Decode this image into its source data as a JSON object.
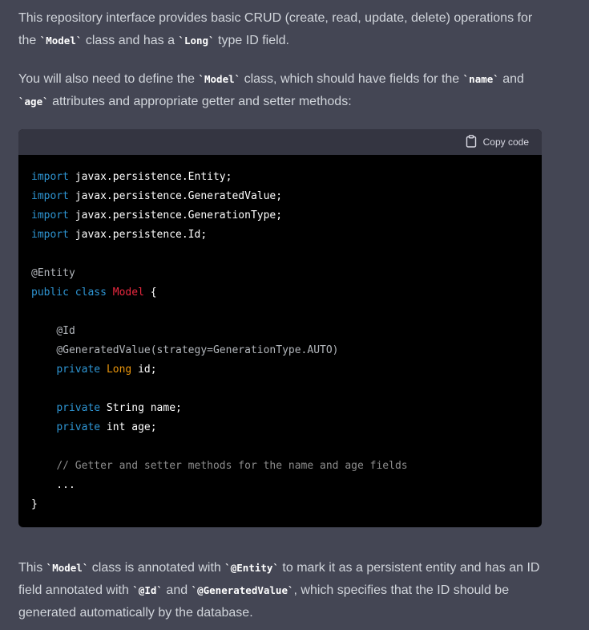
{
  "intro": {
    "p1": [
      "This repository interface provides basic CRUD (create, read, update, delete) operations for the ",
      "`Model`",
      " class and has a ",
      "`Long`",
      " type ID field."
    ],
    "p2": [
      "You will also need to define the ",
      "`Model`",
      " class, which should have fields for the ",
      "`name`",
      " and ",
      "`age`",
      " attributes and appropriate getter and setter methods:"
    ]
  },
  "code_block": {
    "copy_label": "Copy code",
    "copy_icon": "clipboard-icon",
    "lines": [
      [
        {
          "t": "import",
          "c": "kw"
        },
        {
          "t": " javax.persistence.Entity;"
        }
      ],
      [
        {
          "t": "import",
          "c": "kw"
        },
        {
          "t": " javax.persistence.GeneratedValue;"
        }
      ],
      [
        {
          "t": "import",
          "c": "kw"
        },
        {
          "t": " javax.persistence.GenerationType;"
        }
      ],
      [
        {
          "t": "import",
          "c": "kw"
        },
        {
          "t": " javax.persistence.Id;"
        }
      ],
      [],
      [
        {
          "t": "@Entity",
          "c": "anno"
        }
      ],
      [
        {
          "t": "public",
          "c": "kw"
        },
        {
          "t": " "
        },
        {
          "t": "class",
          "c": "kw"
        },
        {
          "t": " "
        },
        {
          "t": "Model",
          "c": "cls"
        },
        {
          "t": " {"
        }
      ],
      [],
      [
        {
          "t": "    "
        },
        {
          "t": "@Id",
          "c": "anno"
        }
      ],
      [
        {
          "t": "    "
        },
        {
          "t": "@GeneratedValue(strategy=GenerationType.AUTO)",
          "c": "anno"
        }
      ],
      [
        {
          "t": "    "
        },
        {
          "t": "private",
          "c": "kw"
        },
        {
          "t": " "
        },
        {
          "t": "Long",
          "c": "type"
        },
        {
          "t": " id;"
        }
      ],
      [],
      [
        {
          "t": "    "
        },
        {
          "t": "private",
          "c": "kw"
        },
        {
          "t": " String name;"
        }
      ],
      [
        {
          "t": "    "
        },
        {
          "t": "private",
          "c": "kw"
        },
        {
          "t": " int age;"
        }
      ],
      [],
      [
        {
          "t": "    "
        },
        {
          "t": "// Getter and setter methods for the name and age fields",
          "c": "cm"
        }
      ],
      [
        {
          "t": "    ..."
        }
      ],
      [
        {
          "t": "}"
        }
      ]
    ]
  },
  "outro": {
    "p3": [
      "This ",
      "`Model`",
      " class is annotated with ",
      "`@Entity`",
      " to mark it as a persistent entity and has an ID field annotated with ",
      "`@Id`",
      " and ",
      "`@GeneratedValue`",
      ", which specifies that the ID should be generated automatically by the database."
    ]
  }
}
